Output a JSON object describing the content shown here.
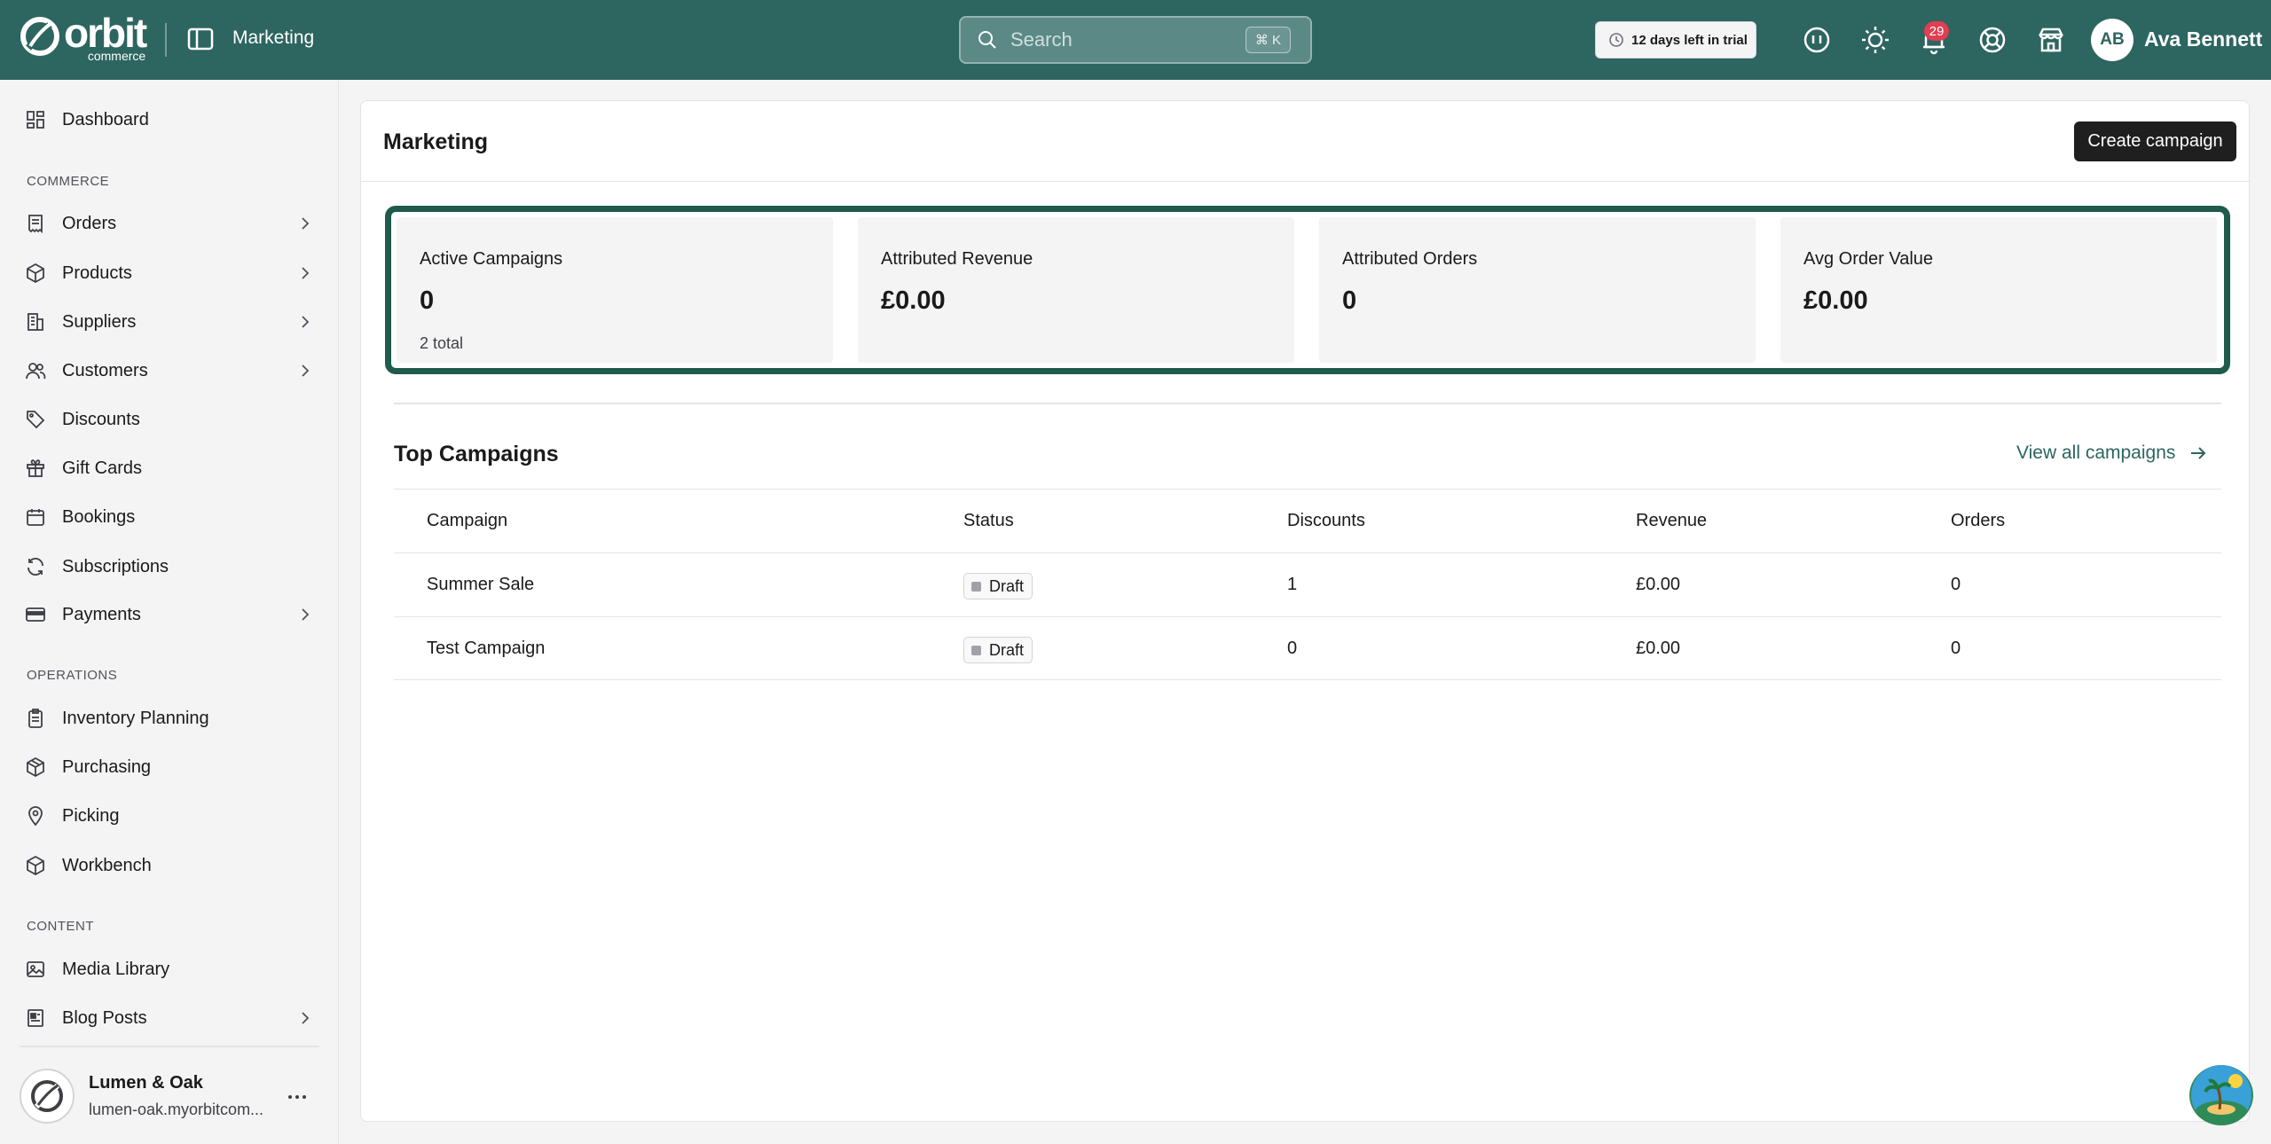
{
  "brand": {
    "name": "orbit",
    "tagline": "commerce"
  },
  "header": {
    "title": "Marketing",
    "search_placeholder": "Search",
    "search_shortcut": "⌘ K",
    "trial_text": "12 days left in trial",
    "notifications_count": "29",
    "user_initials": "AB",
    "user_name": "Ava Bennett"
  },
  "sidebar": {
    "dashboard": "Dashboard",
    "sections": {
      "commerce": "COMMERCE",
      "operations": "OPERATIONS",
      "content": "CONTENT"
    },
    "commerce_items": [
      "Orders",
      "Products",
      "Suppliers",
      "Customers",
      "Discounts",
      "Gift Cards",
      "Bookings",
      "Subscriptions",
      "Payments"
    ],
    "operations_items": [
      "Inventory Planning",
      "Purchasing",
      "Picking",
      "Workbench"
    ],
    "content_items": [
      "Media Library",
      "Blog Posts"
    ],
    "store": {
      "name": "Lumen & Oak",
      "url": "lumen-oak.myorbitcom..."
    }
  },
  "main": {
    "title": "Marketing",
    "create_button": "Create campaign",
    "stats": [
      {
        "label": "Active Campaigns",
        "value": "0",
        "sub": "2 total"
      },
      {
        "label": "Attributed Revenue",
        "value": "£0.00",
        "sub": ""
      },
      {
        "label": "Attributed Orders",
        "value": "0",
        "sub": ""
      },
      {
        "label": "Avg Order Value",
        "value": "£0.00",
        "sub": ""
      }
    ],
    "top_campaigns": {
      "title": "Top Campaigns",
      "view_all": "View all campaigns",
      "columns": [
        "Campaign",
        "Status",
        "Discounts",
        "Revenue",
        "Orders"
      ],
      "rows": [
        {
          "campaign": "Summer Sale",
          "status": "Draft",
          "discounts": "1",
          "revenue": "£0.00",
          "orders": "0"
        },
        {
          "campaign": "Test Campaign",
          "status": "Draft",
          "discounts": "0",
          "revenue": "£0.00",
          "orders": "0"
        }
      ]
    }
  },
  "colors": {
    "header_bg": "#2d6560",
    "stats_border": "#1f5a4c",
    "badge": "#e03e52",
    "link": "#2d6560"
  }
}
